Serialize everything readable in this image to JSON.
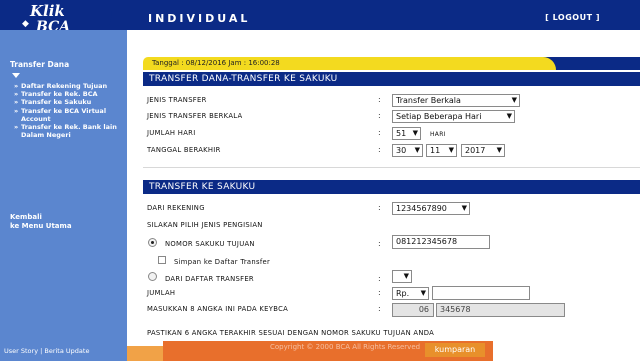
{
  "header": {
    "logo_top": "Klik",
    "logo_bottom": "BCA",
    "title": "INDIVIDUAL",
    "logout": "[ LOGOUT ]"
  },
  "sidebar": {
    "title": "Transfer Dana",
    "items": [
      {
        "label": "Daftar Rekening Tujuan"
      },
      {
        "label": "Transfer ke Rek. BCA"
      },
      {
        "label": "Transfer ke Sakuku"
      },
      {
        "label": "Transfer ke BCA Virtual Account"
      },
      {
        "label": "Transfer ke Rek. Bank lain Dalam Negeri"
      }
    ],
    "back_line1": "Kembali",
    "back_line2": "ke Menu Utama",
    "footer": "User Story | Berita Update"
  },
  "datetime": "Tanggal : 08/12/2016 Jam : 16:00:28",
  "section1": {
    "title": "TRANSFER DANA-TRANSFER KE SAKUKU",
    "jenis_transfer_label": "JENIS TRANSFER",
    "jenis_transfer_value": "Transfer Berkala",
    "jenis_berkala_label": "JENIS TRANSFER BERKALA",
    "jenis_berkala_value": "Setiap Beberapa Hari",
    "jumlah_hari_label": "JUMLAH HARI",
    "jumlah_hari_value": "51",
    "hari_unit": "HARI",
    "tanggal_label": "TANGGAL BERAKHIR",
    "tanggal_day": "30",
    "tanggal_month": "11",
    "tanggal_year": "2017"
  },
  "section2": {
    "title": "TRANSFER KE SAKUKU",
    "dari_rekening_label": "DARI REKENING",
    "dari_rekening_value": "1234567890",
    "pilih_jenis_label": "SILAKAN PILIH JENIS PENGISIAN",
    "nomor_sakuku_label": "NOMOR SAKUKU TUJUAN",
    "nomor_sakuku_value": "081212345678",
    "simpan_label": "Simpan ke Daftar Transfer",
    "dari_daftar_label": "DARI DAFTAR TRANSFER",
    "dari_daftar_value": "",
    "jumlah_label": "JUMLAH",
    "currency": "Rp.",
    "jumlah_value": "",
    "keybca_label": "MASUKKAN 8 ANGKA INI PADA KEYBCA",
    "keybca_prefix": "06",
    "keybca_code": "345678",
    "note": "PASTIKAN 6 ANGKA TERAKHIR SESUAI DENGAN NOMOR SAKUKU TUJUAN ANDA"
  },
  "footer": {
    "copyright": "Copyright © 2000 BCA All Rights Reserved",
    "watermark": "kumparan"
  },
  "colors": {
    "navy": "#0b2a86",
    "sidebar_blue": "#5b86cf",
    "yellow": "#f3da1f",
    "overlay_orange": "#e86f2c"
  },
  "icons": {
    "logo": "klikbca-logo",
    "sidebar_arrow": "triangle-down-icon",
    "bullets": "double-chevron-icon"
  }
}
